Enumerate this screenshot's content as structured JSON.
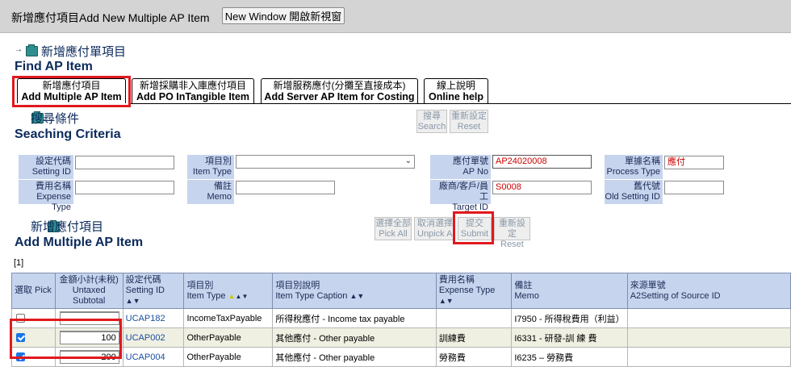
{
  "window": {
    "title": "新增應付項目Add New Multiple AP Item",
    "new_window_button": "New Window 開啟新視窗"
  },
  "header": {
    "arrow": "→",
    "title_cn": "新增應付單項目",
    "title_en": "Find AP Item"
  },
  "tabs": [
    {
      "label_cn": "新增應付項目",
      "label_en": "Add Multiple AP Item"
    },
    {
      "label_cn": "新增採購非入庫應付項目",
      "label_en": "Add PO InTangible Item"
    },
    {
      "label_cn": "新增服務應付(分攤至直接成本)",
      "label_en": "Add Server AP Item for Costing"
    },
    {
      "label_cn": "線上說明",
      "label_en": "Online help"
    }
  ],
  "search": {
    "title_cn": "搜尋條件",
    "title_en": "Seaching Criteria",
    "search_button": {
      "cn": "搜尋",
      "en": "Search"
    },
    "reset_button": {
      "cn": "重新設定",
      "en": "Reset"
    },
    "fields": {
      "setting_id": {
        "label_cn": "設定代碼",
        "label_en": "Setting ID",
        "value": ""
      },
      "item_type": {
        "label_cn": "項目別",
        "label_en": "Item Type",
        "value": ""
      },
      "ap_no": {
        "label_cn": "應付單號",
        "label_en": "AP No",
        "value": "AP24020008"
      },
      "process_type": {
        "label_cn": "單據名稱",
        "label_en": "Process Type",
        "value": "應付"
      },
      "expense_type": {
        "label_cn": "費用名稱",
        "label_en": "Expense Type",
        "value": ""
      },
      "memo": {
        "label_cn": "備註",
        "label_en": "Memo",
        "value": ""
      },
      "target_id": {
        "label_cn": "廠商/客戶/員工",
        "label_en": "Target ID",
        "value": "S0008"
      },
      "old_setting_id": {
        "label_cn": "舊代號",
        "label_en": "Old Setting ID",
        "value": ""
      }
    }
  },
  "multi": {
    "title_cn": "新增應付項目",
    "title_en": "Add Multiple AP Item",
    "pick_all": {
      "cn": "選擇全部",
      "en": "Pick All"
    },
    "unpick_all": {
      "cn": "取消選擇",
      "en": "Unpick All"
    },
    "submit": {
      "cn": "提交",
      "en": "Submit"
    },
    "reset": {
      "cn": "重新設定",
      "en": "Reset"
    },
    "page_indicator": "[1]"
  },
  "table": {
    "headers": {
      "pick": "選取 Pick",
      "subtotal_cn": "金額小計(未稅)",
      "subtotal_en": "Untaxed Subtotal",
      "setting_cn": "設定代碼",
      "setting_en": "Setting ID",
      "item_type_cn": "項目別",
      "item_type_en": "Item Type",
      "caption_cn": "項目別說明",
      "caption_en": "Item Type Caption",
      "expense_cn": "費用名稱",
      "expense_en": "Expense Type",
      "memo_cn": "備註",
      "memo_en": "Memo",
      "source_cn": "來源單號",
      "source_en": "A2Setting of Source ID"
    },
    "sort_up_down": "▲▼",
    "sort_tri": "▲",
    "rows": [
      {
        "checked": false,
        "subtotal": "",
        "setting_id": "UCAP182",
        "item_type": "IncomeTaxPayable",
        "caption": "所得稅應付 - Income tax payable",
        "expense": "",
        "memo": "I7950 - 所得稅費用（利益）",
        "source": ""
      },
      {
        "checked": true,
        "subtotal": "100",
        "setting_id": "UCAP002",
        "item_type": "OtherPayable",
        "caption": "其他應付 - Other payable",
        "expense": "訓練費",
        "memo": "I6331 - 研發-訓 練 費",
        "source": ""
      },
      {
        "checked": true,
        "subtotal": "200",
        "setting_id": "UCAP004",
        "item_type": "OtherPayable",
        "caption": "其他應付 - Other payable",
        "expense": "勞務費",
        "memo": "I6235 – 勞務費",
        "source": ""
      }
    ]
  }
}
